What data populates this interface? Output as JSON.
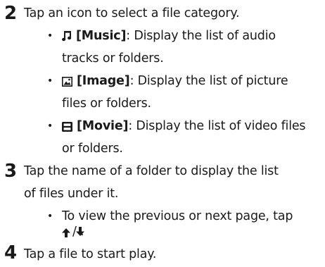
{
  "step2": {
    "number": "2",
    "instruction": "Tap an icon to select a file category.",
    "bullets": [
      {
        "label": "[Music]",
        "icon": "music-note-icon",
        "lines": [
          ": Display the list of audio",
          "tracks or folders."
        ]
      },
      {
        "label": "[Image]",
        "icon": "image-icon",
        "lines": [
          ": Display the list of picture",
          "files or folders."
        ]
      },
      {
        "label": "[Movie]",
        "icon": "movie-icon",
        "lines": [
          ": Display the list of video files",
          "or folders."
        ]
      }
    ]
  },
  "step3": {
    "number": "3",
    "instruction_lines": [
      "Tap the name of a folder to display the list",
      "of files under it."
    ],
    "bullet_lines": [
      "To view the previous or next page, tap",
      "/ ."
    ]
  },
  "step4": {
    "number": "4",
    "instruction": "Tap a file to start play."
  }
}
